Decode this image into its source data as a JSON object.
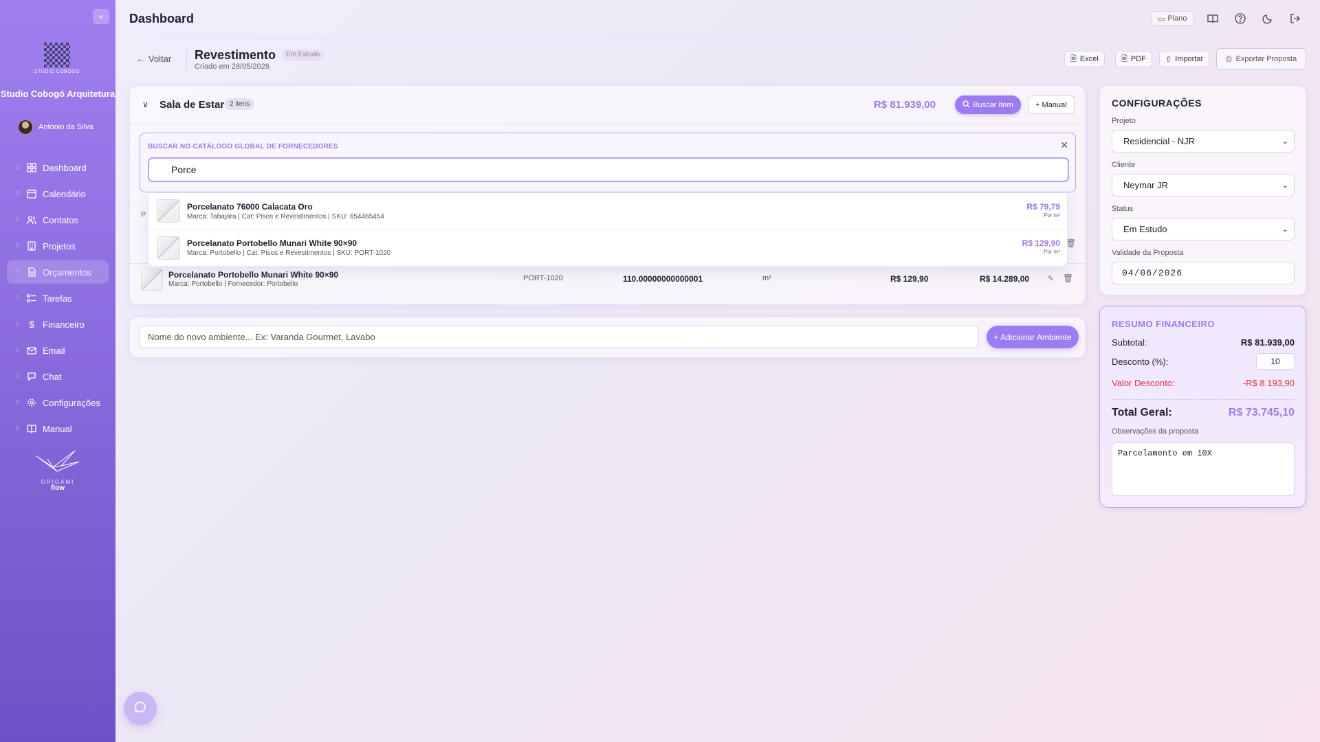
{
  "sidebar": {
    "logo_text": "STUDIO COBOGÓ",
    "brand_name": "Studio Cobogó Arquitetura",
    "user_name": "Antonio da Silva",
    "items": [
      {
        "label": "Dashboard",
        "icon": "grid-icon"
      },
      {
        "label": "Calendário",
        "icon": "calendar-icon"
      },
      {
        "label": "Contatos",
        "icon": "users-icon"
      },
      {
        "label": "Projetos",
        "icon": "building-icon"
      },
      {
        "label": "Orçamentos",
        "icon": "document-icon",
        "active": true
      },
      {
        "label": "Tarefas",
        "icon": "list-icon"
      },
      {
        "label": "Financeiro",
        "icon": "dollar-icon"
      },
      {
        "label": "Email",
        "icon": "mail-icon"
      },
      {
        "label": "Chat",
        "icon": "chat-icon"
      },
      {
        "label": "Configurações",
        "icon": "gear-icon"
      },
      {
        "label": "Manual",
        "icon": "book-icon"
      }
    ],
    "footer_logo_line1": "ORIGAMI",
    "footer_logo_line2": "flow"
  },
  "topbar": {
    "title": "Dashboard",
    "plan_label": "Plano"
  },
  "header": {
    "back_label": "Voltar",
    "doc_title": "Revestimento",
    "status_badge": "Em Estudo",
    "created": "Criado em 28/05/2026",
    "excel_label": "Excel",
    "pdf_label": "PDF",
    "import_label": "Importar",
    "export_label": "Exportar Proposta"
  },
  "room": {
    "title": "Sala de Estar",
    "items_count": "2 itens",
    "total": "R$ 81.939,00",
    "search_button": "Buscar Item",
    "manual_button": "+ Manual",
    "search_label": "BUSCAR NO CATÁLOGO GLOBAL DE FORNECEDORES",
    "search_value": "Porce",
    "column_peek": "P",
    "results": [
      {
        "name": "Porcelanato 76000 Calacata Oro",
        "meta": "Marca: Tabajara | Cat: Pisos e Revestimentos | SKU: 654465454",
        "price": "R$ 79,79",
        "unit": "Por m²"
      },
      {
        "name": "Porcelanato Portobello Munari White 90×90",
        "meta": "Marca: Portobello | Cat: Pisos e Revestimentos | SKU: PORT-1020",
        "price": "R$ 129,90",
        "unit": "Por m²"
      }
    ],
    "row": {
      "name": "Porcelanato Portobello Munari White 90×90",
      "meta": "Marca: Portobello | Fornecedor: Portobello",
      "sku": "PORT-1020",
      "qty": "110.00000000000001",
      "unit": "m²",
      "price": "R$ 129,90",
      "total": "R$ 14.289,00"
    }
  },
  "new_env": {
    "placeholder": "Nome do novo ambiente... Ex: Varanda Gourmet, Lavabo",
    "button": "+ Adicionar Ambiente"
  },
  "config": {
    "title": "CONFIGURAÇÕES",
    "project_label": "Projeto",
    "project_value": "Residencial - NJR",
    "client_label": "Cliente",
    "client_value": "Neymar JR",
    "status_label": "Status",
    "status_value": "Em Estudo",
    "validity_label": "Validade da Proposta",
    "validity_value": "04/06/2026"
  },
  "finance": {
    "title": "RESUMO FINANCEIRO",
    "subtotal_label": "Subtotal:",
    "subtotal_value": "R$ 81.939,00",
    "discount_label": "Desconto (%):",
    "discount_value": "10",
    "discount_amount_label": "Valor Desconto:",
    "discount_amount_value": "-R$ 8.193,90",
    "total_label": "Total Geral:",
    "total_value": "R$ 73.745,10",
    "obs_label": "Observações da proposta",
    "obs_value": "Parcelamento em 10X"
  },
  "colors": {
    "accent": "#9c7cf0",
    "sidebar_top": "#a07ff0",
    "sidebar_bottom": "#6f51c7",
    "danger": "#e0303d"
  }
}
